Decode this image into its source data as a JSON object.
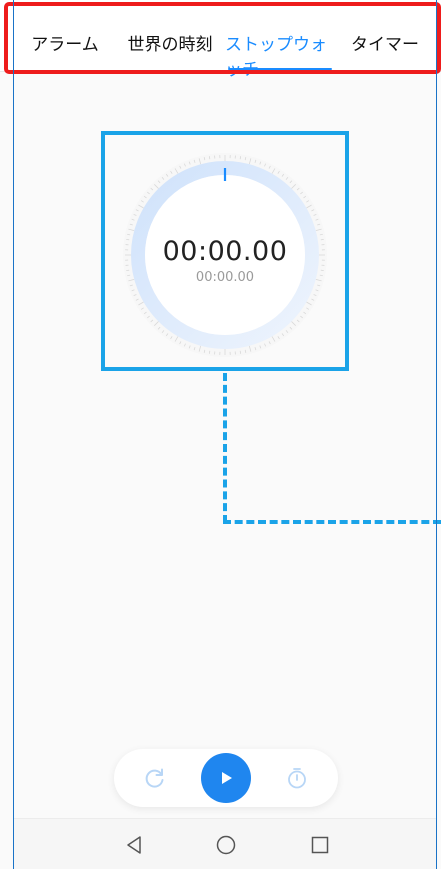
{
  "tabs": [
    {
      "label": "アラーム"
    },
    {
      "label": "世界の時刻"
    },
    {
      "label": "ストップウォッチ"
    },
    {
      "label": "タイマー"
    }
  ],
  "active_tab": "ストップウォッチ",
  "stopwatch": {
    "main_time": "00:00.00",
    "lap_time": "00:00.00"
  },
  "icons": {
    "reset": "reset-icon",
    "play": "play-icon",
    "lap": "lap-timer-icon",
    "nav_back": "back-triangle-icon",
    "nav_home": "home-circle-icon",
    "nav_recent": "recent-square-icon"
  },
  "colors": {
    "accent": "#1a8cff",
    "play_button": "#1f86ef",
    "highlight_red": "#ee1c1c",
    "highlight_blue": "#1aa3e8"
  }
}
